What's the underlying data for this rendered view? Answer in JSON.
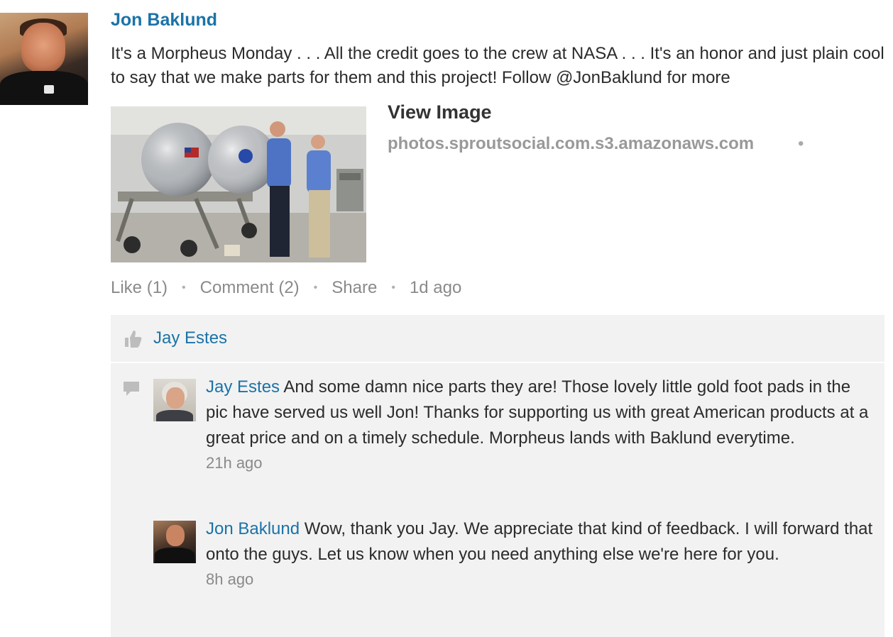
{
  "post": {
    "author": "Jon Baklund",
    "text": "It's a Morpheus Monday . . . All the credit goes to the crew at NASA . . . It's an honor and just plain cool to say that we make parts for them and this project! Follow @JonBaklund for more",
    "attachment": {
      "title": "View Image",
      "source": "photos.sproutsocial.com.s3.amazonaws.com",
      "separator": "•"
    },
    "actions": {
      "like": "Like (1)",
      "comment": "Comment (2)",
      "share": "Share",
      "time": "1d ago",
      "separator": "•"
    }
  },
  "likes": {
    "icon": "thumbs-up-icon",
    "names": [
      "Jay Estes"
    ]
  },
  "comments": [
    {
      "author": "Jay Estes",
      "text": "And some damn nice parts they are! Those lovely little gold foot pads in the pic have served us well Jon! Thanks for supporting us with great American products at a great price and on a timely schedule. Morpheus lands with Baklund everytime.",
      "time": "21h ago"
    },
    {
      "author": "Jon Baklund",
      "text": "Wow, thank you Jay. We appreciate that kind of feedback. I will forward that onto the guys. Let us know when you need anything else we're here for you.",
      "time": "8h ago"
    }
  ],
  "colors": {
    "link": "#1a73a8",
    "muted": "#8a8a8a",
    "panel": "#f2f2f2"
  }
}
